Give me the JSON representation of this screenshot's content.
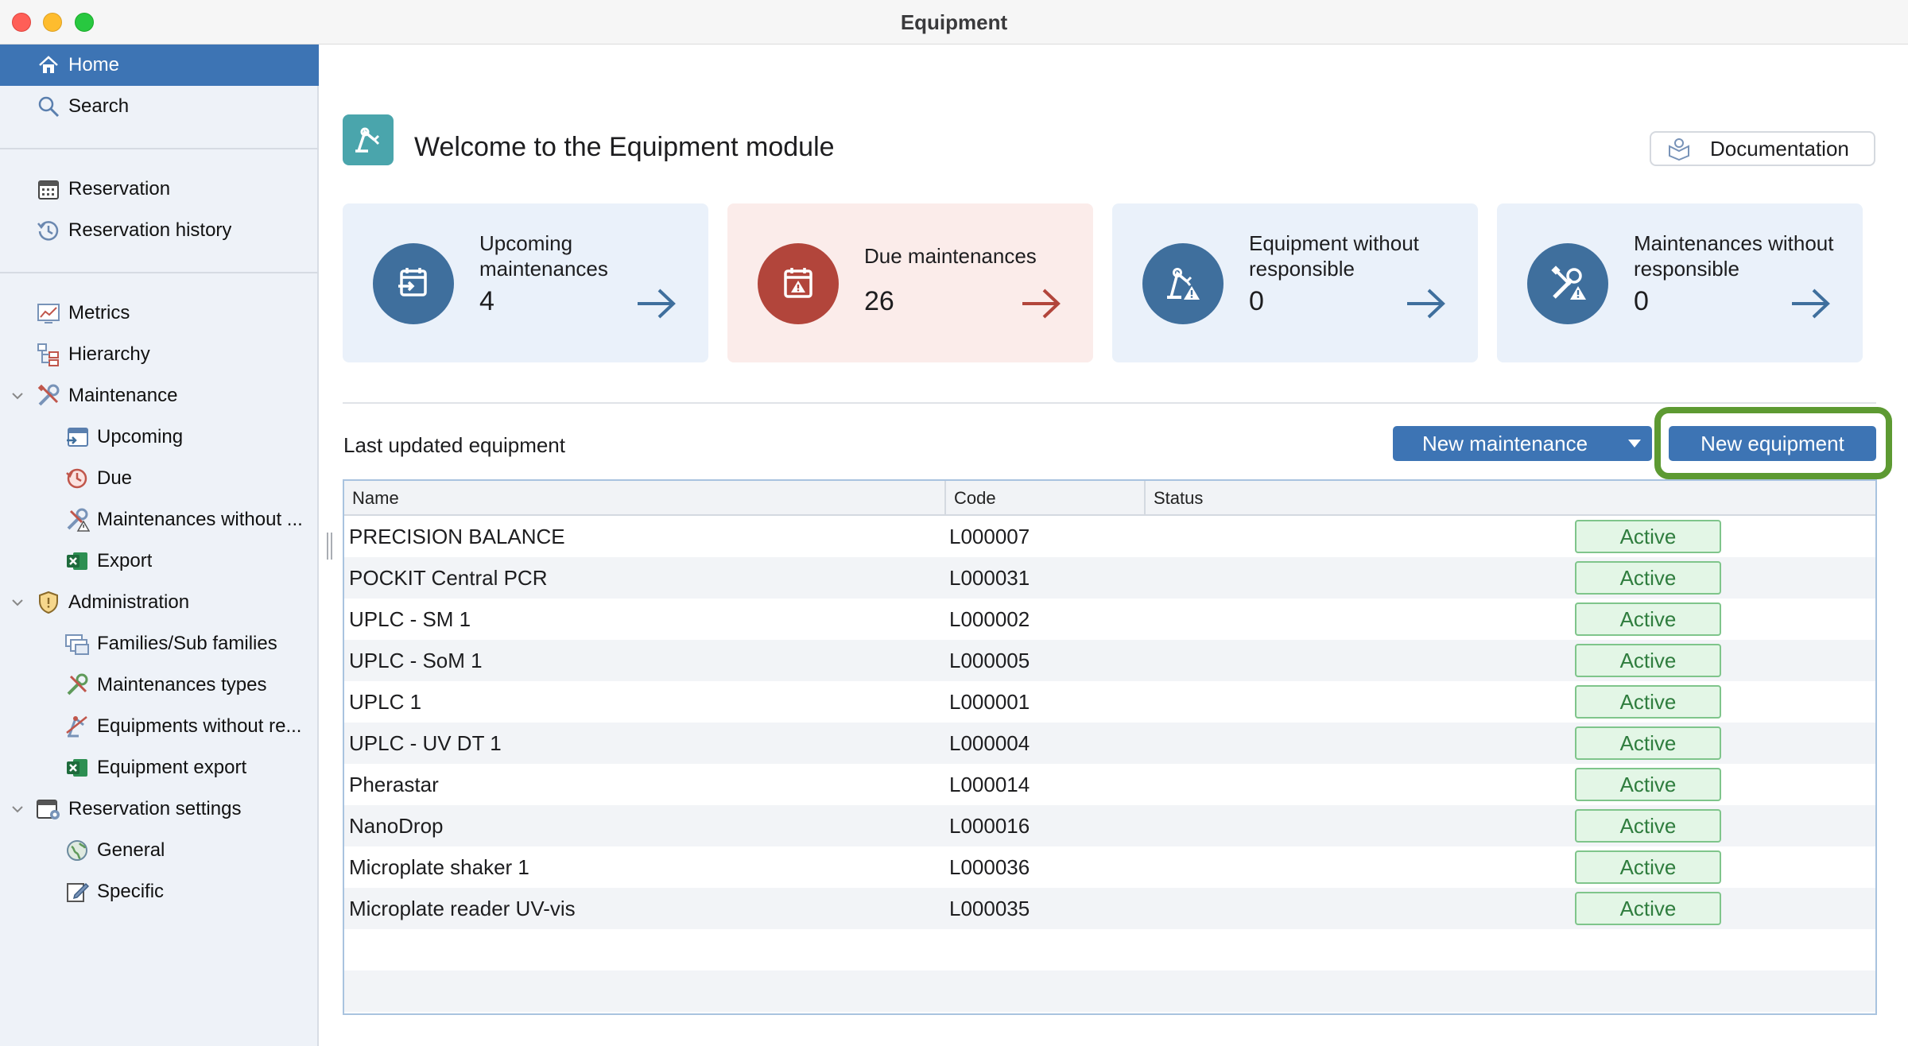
{
  "window": {
    "title": "Equipment"
  },
  "sidebar": {
    "items": [
      {
        "label": "Home",
        "icon": "home-icon"
      },
      {
        "label": "Search",
        "icon": "search-icon"
      },
      {
        "label": "Reservation",
        "icon": "calendar-icon"
      },
      {
        "label": "Reservation history",
        "icon": "history-icon"
      },
      {
        "label": "Metrics",
        "icon": "metrics-icon"
      },
      {
        "label": "Hierarchy",
        "icon": "hierarchy-icon"
      },
      {
        "label": "Maintenance",
        "icon": "tools-icon"
      },
      {
        "label": "Upcoming",
        "icon": "upcoming-calendar-icon"
      },
      {
        "label": "Due",
        "icon": "due-clock-icon"
      },
      {
        "label": "Maintenances without ...",
        "icon": "tools-warning-icon"
      },
      {
        "label": "Export",
        "icon": "excel-icon"
      },
      {
        "label": "Administration",
        "icon": "shield-icon"
      },
      {
        "label": "Families/Sub families",
        "icon": "families-icon"
      },
      {
        "label": "Maintenances types",
        "icon": "tools-icon"
      },
      {
        "label": "Equipments without re...",
        "icon": "equipment-warning-icon"
      },
      {
        "label": "Equipment export",
        "icon": "excel-icon"
      },
      {
        "label": "Reservation settings",
        "icon": "calendar-settings-icon"
      },
      {
        "label": "General",
        "icon": "globe-settings-icon"
      },
      {
        "label": "Specific",
        "icon": "edit-icon"
      }
    ]
  },
  "header": {
    "welcome": "Welcome to the Equipment module",
    "documentation_label": "Documentation"
  },
  "cards": [
    {
      "title": "Upcoming maintenances",
      "count": "4",
      "icon": "calendar-in-icon"
    },
    {
      "title": "Due maintenances",
      "count": "26",
      "icon": "calendar-warning-icon"
    },
    {
      "title": "Equipment without responsible",
      "count": "0",
      "icon": "equipment-warning-icon"
    },
    {
      "title": "Maintenances without responsible",
      "count": "0",
      "icon": "tools-warning-icon"
    }
  ],
  "table_section": {
    "title": "Last updated equipment",
    "new_maintenance_label": "New maintenance",
    "new_equipment_label": "New equipment",
    "columns": [
      "Name",
      "Code",
      "Status"
    ],
    "rows": [
      {
        "name": "PRECISION BALANCE",
        "code": "L000007",
        "status": "Active"
      },
      {
        "name": "POCKIT Central PCR",
        "code": "L000031",
        "status": "Active"
      },
      {
        "name": "UPLC - SM 1",
        "code": "L000002",
        "status": "Active"
      },
      {
        "name": "UPLC - SoM 1",
        "code": "L000005",
        "status": "Active"
      },
      {
        "name": "UPLC 1",
        "code": "L000001",
        "status": "Active"
      },
      {
        "name": "UPLC - UV DT 1",
        "code": "L000004",
        "status": "Active"
      },
      {
        "name": "Pherastar",
        "code": "L000014",
        "status": "Active"
      },
      {
        "name": "NanoDrop",
        "code": "L000016",
        "status": "Active"
      },
      {
        "name": "Microplate shaker 1",
        "code": "L000036",
        "status": "Active"
      },
      {
        "name": "Microplate reader UV-vis",
        "code": "L000035",
        "status": "Active"
      }
    ]
  },
  "colors": {
    "accent": "#3d74b4",
    "card_icon_blue": "#3f6f9d",
    "card_icon_red": "#b2453b",
    "status_green": "#2f7d3e",
    "highlight_green": "#5d9a32"
  }
}
